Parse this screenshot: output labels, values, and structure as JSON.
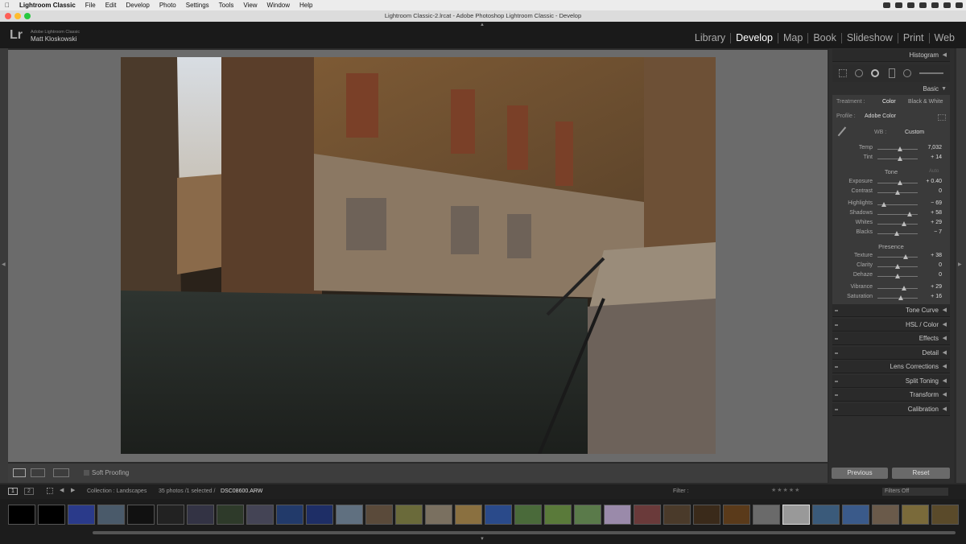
{
  "menubar": {
    "apple": "",
    "app": "Lightroom Classic",
    "items": [
      "File",
      "Edit",
      "Develop",
      "Photo",
      "Settings",
      "Tools",
      "View",
      "Window",
      "Help"
    ]
  },
  "window": {
    "title": "Lightroom Classic-2.lrcat - Adobe Photoshop Lightroom Classic - Develop"
  },
  "identity": {
    "logo": "Lr",
    "line1": "Adobe Lightroom Classic",
    "line2": "Matt Kloskowski"
  },
  "modules": [
    {
      "label": "Library",
      "active": false
    },
    {
      "label": "Develop",
      "active": true
    },
    {
      "label": "Map",
      "active": false
    },
    {
      "label": "Book",
      "active": false
    },
    {
      "label": "Slideshow",
      "active": false
    },
    {
      "label": "Print",
      "active": false
    },
    {
      "label": "Web",
      "active": false
    }
  ],
  "right_panel": {
    "histogram": "Histogram",
    "basic": "Basic",
    "treatment_label": "Treatment :",
    "treatment_color": "Color",
    "treatment_bw": "Black & White",
    "profile_label": "Profile :",
    "profile_value": "Adobe Color",
    "wb_label": "WB :",
    "wb_value": "Custom",
    "tone": "Tone",
    "tone_auto": "Auto",
    "presence": "Presence",
    "sliders": [
      {
        "label": "Temp",
        "value": "7,032",
        "pos": 0.55
      },
      {
        "label": "Tint",
        "value": "+ 14",
        "pos": 0.55
      },
      {
        "label": "Exposure",
        "value": "+ 0.40",
        "pos": 0.55
      },
      {
        "label": "Contrast",
        "value": "0",
        "pos": 0.5
      },
      {
        "label": "Highlights",
        "value": "− 69",
        "pos": 0.16
      },
      {
        "label": "Shadows",
        "value": "+ 58",
        "pos": 0.79
      },
      {
        "label": "Whites",
        "value": "+ 29",
        "pos": 0.65
      },
      {
        "label": "Blacks",
        "value": "− 7",
        "pos": 0.47
      },
      {
        "label": "Texture",
        "value": "+ 38",
        "pos": 0.69
      },
      {
        "label": "Clarity",
        "value": "0",
        "pos": 0.5
      },
      {
        "label": "Dehaze",
        "value": "0",
        "pos": 0.5
      },
      {
        "label": "Vibrance",
        "value": "+ 29",
        "pos": 0.65
      },
      {
        "label": "Saturation",
        "value": "+ 16",
        "pos": 0.58
      }
    ],
    "panels": [
      "Tone Curve",
      "HSL / Color",
      "Effects",
      "Detail",
      "Lens Corrections",
      "Split Toning",
      "Transform",
      "Calibration"
    ],
    "previous": "Previous",
    "reset": "Reset"
  },
  "toolbar": {
    "soft_proofing": "Soft Proofing"
  },
  "filmstrip_bar": {
    "page1": "1",
    "page2": "2",
    "collection": "Collection : Landscapes",
    "count": "35 photos /1 selected /",
    "filename": "DSC08600.ARW",
    "filter": "Filter :",
    "filters_off": "Filters Off"
  },
  "colors": {
    "accent": "#ffffff",
    "panel": "#3a3a3a"
  }
}
